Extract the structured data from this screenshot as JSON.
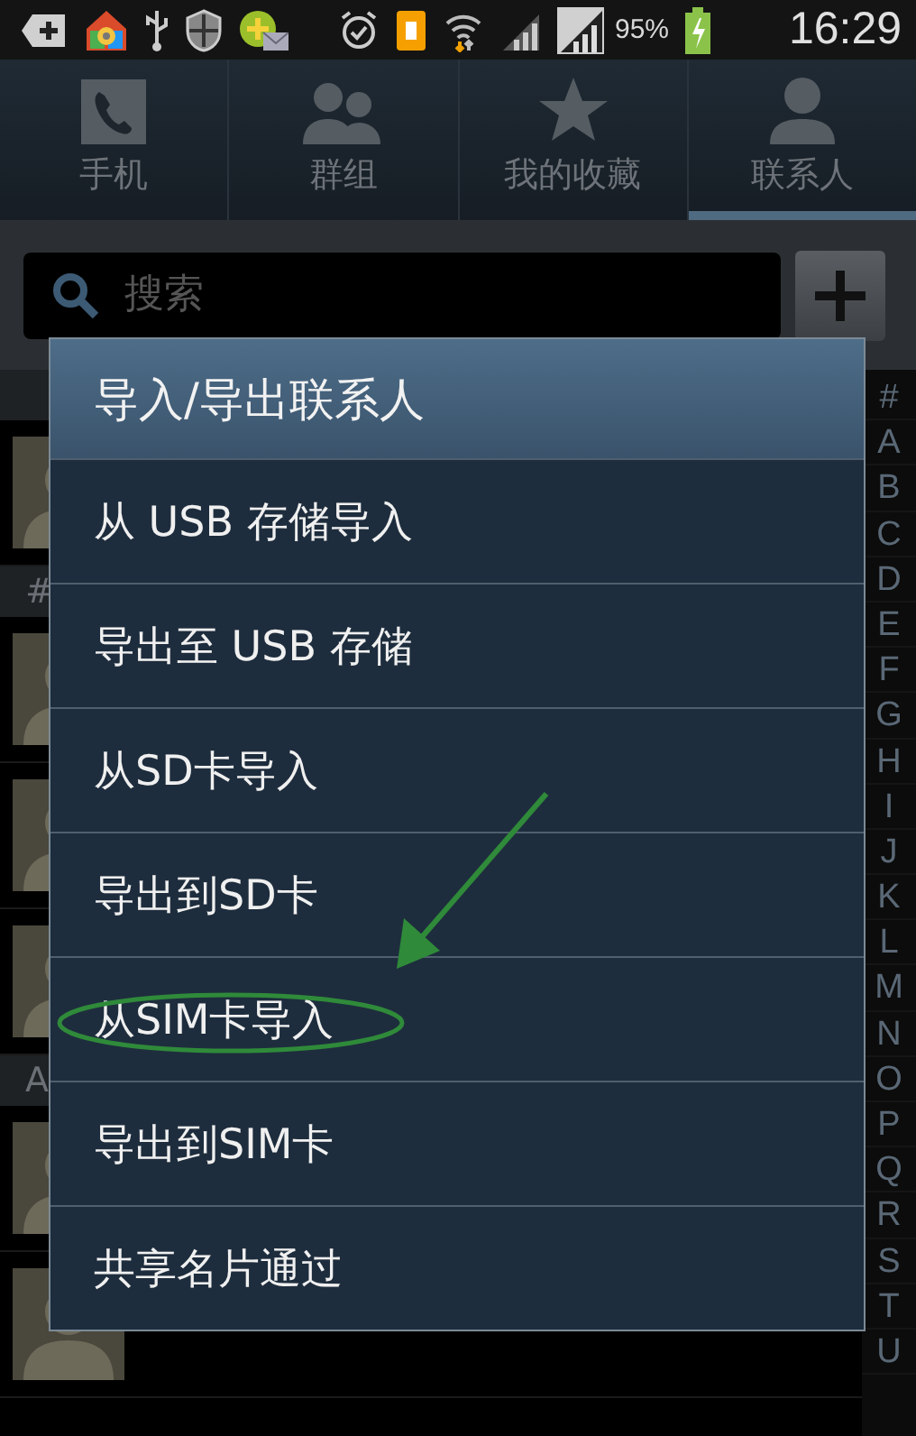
{
  "status_bar": {
    "battery": "95%",
    "time": "16:29"
  },
  "tabs": [
    {
      "label": "手机",
      "kind": "phone",
      "selected": false
    },
    {
      "label": "群组",
      "kind": "group",
      "selected": false
    },
    {
      "label": "我的收藏",
      "kind": "star",
      "selected": false
    },
    {
      "label": "联系人",
      "kind": "person",
      "selected": true
    }
  ],
  "search": {
    "placeholder": "搜索"
  },
  "contact_list": {
    "sections": [
      {
        "contacts": [
          {
            "kind": "avatar"
          }
        ]
      },
      {
        "label": "#",
        "contacts": [
          {
            "kind": "avatar"
          },
          {
            "kind": "avatar"
          },
          {
            "kind": "avatar"
          }
        ]
      },
      {
        "label": "A",
        "contacts": [
          {
            "kind": "avatar"
          },
          {
            "kind": "avatar"
          }
        ]
      }
    ]
  },
  "index_bar": [
    "#",
    "A",
    "B",
    "C",
    "D",
    "E",
    "F",
    "G",
    "H",
    "I",
    "J",
    "K",
    "L",
    "M",
    "N",
    "O",
    "P",
    "Q",
    "R",
    "S",
    "T",
    "U"
  ],
  "dialog": {
    "title": "导入/导出联系人",
    "items": [
      {
        "label": "从 USB 存储导入",
        "circled": false
      },
      {
        "label": "导出至 USB 存储",
        "circled": false
      },
      {
        "label": "从SD卡导入",
        "circled": false
      },
      {
        "label": "导出到SD卡",
        "circled": false
      },
      {
        "label": "从SIM卡导入",
        "circled": true
      },
      {
        "label": "导出到SIM卡",
        "circled": false
      },
      {
        "label": "共享名片通过",
        "circled": false
      }
    ]
  }
}
